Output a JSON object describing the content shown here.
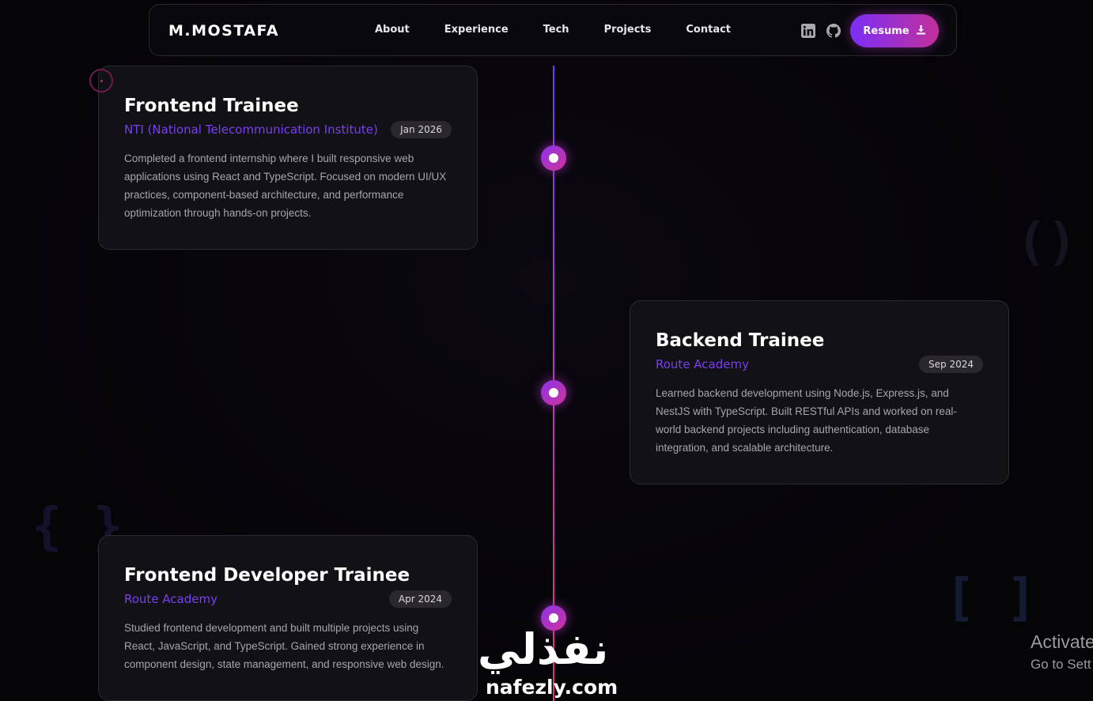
{
  "nav": {
    "logo": "M.MOSTAFA",
    "links": [
      "About",
      "Experience",
      "Tech",
      "Projects",
      "Contact"
    ],
    "icons": [
      "linkedin-icon",
      "github-icon"
    ],
    "resume_label": "Resume",
    "resume_icon": "download-icon"
  },
  "colors": {
    "accent_purple": "#7b2ff7",
    "accent_pink": "#c2309a",
    "org_text": "#7a3ff2",
    "card_bg": "#121115"
  },
  "timeline": {
    "items": [
      {
        "title": "Frontend Trainee",
        "org": "NTI (National Telecommunication Institute)",
        "date": "Jan 2026",
        "description": "Completed a frontend internship where I built responsive web applications using React and TypeScript. Focused on modern UI/UX practices, component-based architecture, and performance optimization through hands-on projects."
      },
      {
        "title": "Backend Trainee",
        "org": "Route Academy",
        "date": "Sep 2024",
        "description": "Learned backend development using Node.js, Express.js, and NestJS with TypeScript. Built RESTful APIs and worked on real-world backend projects including authentication, database integration, and scalable architecture."
      },
      {
        "title": "Frontend Developer Trainee",
        "org": "Route Academy",
        "date": "Apr 2024",
        "description": "Studied frontend development and built multiple projects using React, JavaScript, and TypeScript. Gained strong experience in component design, state management, and responsive web design."
      }
    ]
  },
  "watermark": {
    "arabic": "نفذلي",
    "latin": "nafezly.com"
  },
  "os_overlay": {
    "title": "Activate",
    "subtitle": "Go to Sett"
  }
}
